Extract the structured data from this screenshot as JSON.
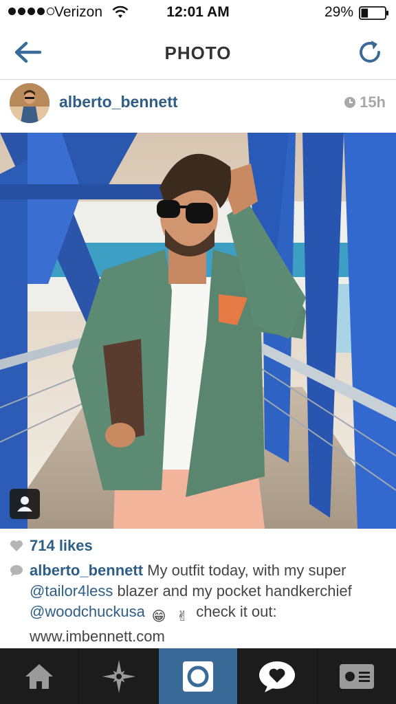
{
  "status_bar": {
    "carrier": "Verizon",
    "time": "12:01 AM",
    "battery": "29%",
    "battery_level": 0.29,
    "signal_bars": 4
  },
  "header": {
    "title": "PHOTO",
    "back_icon": "back-arrow-icon",
    "refresh_icon": "refresh-icon"
  },
  "post": {
    "username": "alberto_bennett",
    "time_ago": "15h",
    "likes": "714 likes",
    "caption": {
      "user": "alberto_bennett",
      "text1": " My outfit today, with my super ",
      "mention1": "@tailor4less",
      "text2": " blazer and my pocket handkerchief ",
      "mention2": "@woodchuckusa",
      "emoji1": "😁",
      "emoji2": "✌",
      "text3": " check it out: www.imbennett.com"
    }
  },
  "colors": {
    "accent": "#2e5e86",
    "tabbar": "#1c1c1c",
    "tab_active": "#3a6a98"
  },
  "tabs": [
    {
      "name": "home",
      "icon": "home-icon"
    },
    {
      "name": "explore",
      "icon": "explore-star-icon"
    },
    {
      "name": "camera",
      "icon": "camera-icon"
    },
    {
      "name": "activity",
      "icon": "activity-heart-icon"
    },
    {
      "name": "profile",
      "icon": "profile-card-icon"
    }
  ]
}
